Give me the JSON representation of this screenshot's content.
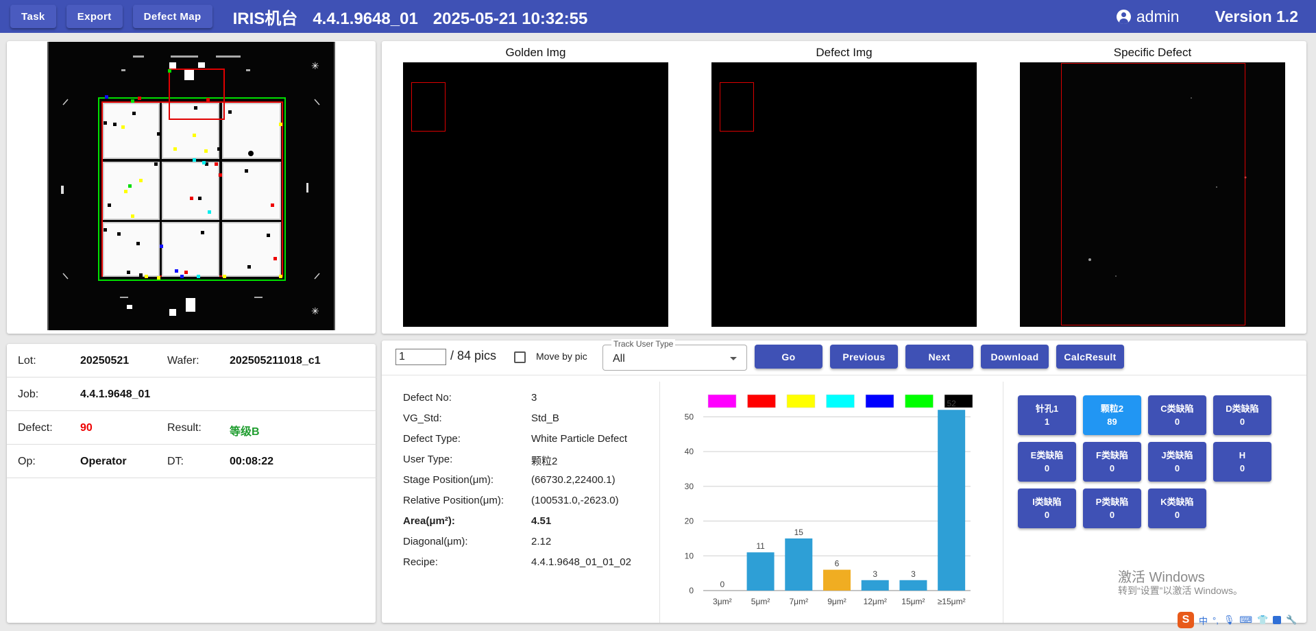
{
  "header": {
    "buttons": [
      "Task",
      "Export",
      "Defect Map"
    ],
    "title_machine": "IRIS机台",
    "title_job": "4.4.1.9648_01",
    "title_datetime": "2025-05-21 10:32:55",
    "user": "admin",
    "version": "Version 1.2"
  },
  "info": {
    "lot_label": "Lot:",
    "lot_value": "20250521",
    "wafer_label": "Wafer:",
    "wafer_value": "202505211018_c1",
    "job_label": "Job:",
    "job_value": "4.4.1.9648_01",
    "defect_label": "Defect:",
    "defect_value": "90",
    "result_label": "Result:",
    "result_value": "等级B",
    "op_label": "Op:",
    "op_value": "Operator",
    "dt_label": "DT:",
    "dt_value": "00:08:22"
  },
  "images": {
    "golden": "Golden Img",
    "defect": "Defect Img",
    "specific": "Specific Defect"
  },
  "controls": {
    "pic_value": "1",
    "pics_total": "/ 84 pics",
    "move_by_pic": "Move by pic",
    "track_label": "Track User Type",
    "track_value": "All",
    "go": "Go",
    "previous": "Previous",
    "next": "Next",
    "download": "Download",
    "calc": "CalcResult"
  },
  "details": [
    {
      "label": "Defect No:",
      "value": "3"
    },
    {
      "label": "VG_Std:",
      "value": "Std_B"
    },
    {
      "label": "Defect Type:",
      "value": "White Particle Defect"
    },
    {
      "label": "User Type:",
      "value": "颗粒2"
    },
    {
      "label": "Stage Position(μm):",
      "value": "(66730.2,22400.1)"
    },
    {
      "label": "Relative Position(μm):",
      "value": "(100531.0,-2623.0)"
    },
    {
      "label": "Area(μm²):",
      "value": "4.51"
    },
    {
      "label": "Diagonal(μm):",
      "value": "2.12"
    },
    {
      "label": "Recipe:",
      "value": "4.4.1.9648_01_01_02"
    }
  ],
  "legend_colors": [
    "#ff00ff",
    "#ff0000",
    "#ffff00",
    "#00ffff",
    "#0000ff",
    "#00ff00",
    "#000000"
  ],
  "chart_data": {
    "type": "bar",
    "categories": [
      "3μm²",
      "5μm²",
      "7μm²",
      "9μm²",
      "12μm²",
      "15μm²",
      "≥15μm²"
    ],
    "values": [
      0,
      11,
      15,
      6,
      3,
      3,
      52
    ],
    "highlight_index": 3,
    "bar_color": "#2e9fd6",
    "highlight_color": "#f0ad22",
    "ylim": [
      0,
      55
    ],
    "yticks": [
      0,
      10,
      20,
      30,
      40,
      50
    ],
    "grid": true
  },
  "categories": [
    {
      "name": "针孔1",
      "count": "1"
    },
    {
      "name": "颗粒2",
      "count": "89",
      "selected": true
    },
    {
      "name": "C类缺陷",
      "count": "0"
    },
    {
      "name": "D类缺陷",
      "count": "0"
    },
    {
      "name": "E类缺陷",
      "count": "0"
    },
    {
      "name": "F类缺陷",
      "count": "0"
    },
    {
      "name": "J类缺陷",
      "count": "0"
    },
    {
      "name": "H",
      "count": "0"
    },
    {
      "name": "I类缺陷",
      "count": "0"
    },
    {
      "name": "P类缺陷",
      "count": "0"
    },
    {
      "name": "K类缺陷",
      "count": "0"
    }
  ],
  "watermark": {
    "line1": "激活 Windows",
    "line2": "转到“设置”以激活 Windows。"
  },
  "ime": {
    "logo": "S",
    "mode": "中"
  }
}
